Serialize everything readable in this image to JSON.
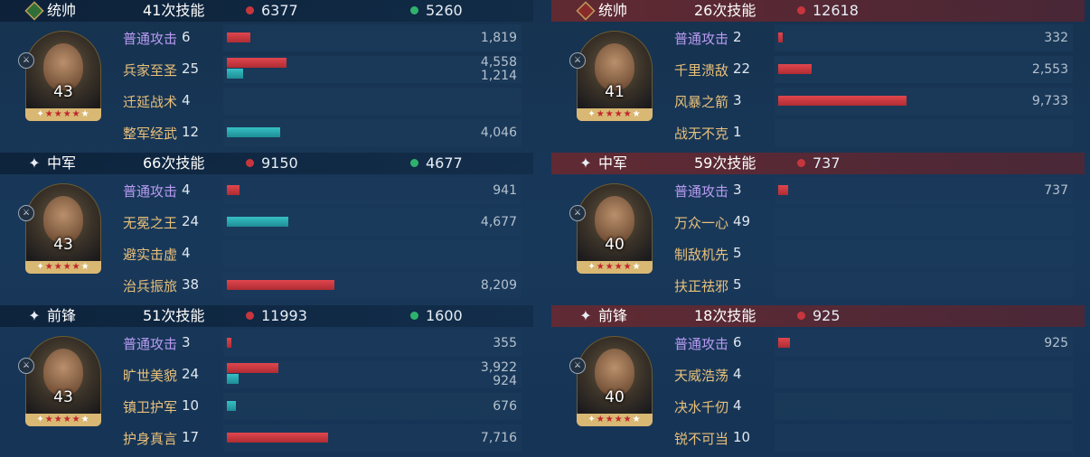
{
  "left": {
    "sections": [
      {
        "role": "统帅",
        "role_icon": "green-diamond-badge-icon",
        "skill_count": "41次技能",
        "damage": "6377",
        "heal": "5260",
        "level": "43",
        "skills": [
          {
            "name": "普通攻击",
            "count": "6",
            "normal": true,
            "red": 1819,
            "red_label": "1,819"
          },
          {
            "name": "兵家至圣",
            "count": "25",
            "red": 4558,
            "red_label": "4,558",
            "teal": 1214,
            "teal_label": "1,214"
          },
          {
            "name": "迁延战术",
            "count": "4"
          },
          {
            "name": "整军经武",
            "count": "12",
            "teal": 4046,
            "teal_label": "4,046"
          }
        ]
      },
      {
        "role": "中军",
        "role_icon": "sparkle-icon",
        "skill_count": "66次技能",
        "damage": "9150",
        "heal": "4677",
        "level": "43",
        "skills": [
          {
            "name": "普通攻击",
            "count": "4",
            "normal": true,
            "red": 941,
            "red_label": "941"
          },
          {
            "name": "无冕之王",
            "count": "24",
            "teal": 4677,
            "teal_label": "4,677"
          },
          {
            "name": "避实击虚",
            "count": "4"
          },
          {
            "name": "治兵振旅",
            "count": "38",
            "red": 8209,
            "red_label": "8,209"
          }
        ]
      },
      {
        "role": "前锋",
        "role_icon": "sparkle-icon",
        "skill_count": "51次技能",
        "damage": "11993",
        "heal": "1600",
        "level": "43",
        "skills": [
          {
            "name": "普通攻击",
            "count": "3",
            "normal": true,
            "red": 355,
            "red_label": "355"
          },
          {
            "name": "旷世美貌",
            "count": "24",
            "red": 3922,
            "red_label": "3,922",
            "teal": 924,
            "teal_label": "924"
          },
          {
            "name": "镇卫护军",
            "count": "10",
            "teal": 676,
            "teal_label": "676"
          },
          {
            "name": "护身真言",
            "count": "17",
            "red": 7716,
            "red_label": "7,716"
          }
        ]
      }
    ]
  },
  "right": {
    "sections": [
      {
        "role": "统帅",
        "role_icon": "red-diamond-badge-icon",
        "skill_count": "26次技能",
        "damage": "12618",
        "level": "41",
        "skills": [
          {
            "name": "普通攻击",
            "count": "2",
            "normal": true,
            "red": 332,
            "red_label": "332"
          },
          {
            "name": "千里溃敌",
            "count": "22",
            "red": 2553,
            "red_label": "2,553"
          },
          {
            "name": "风暴之箭",
            "count": "3",
            "red": 9733,
            "red_label": "9,733"
          },
          {
            "name": "战无不克",
            "count": "1"
          }
        ]
      },
      {
        "role": "中军",
        "role_icon": "sparkle-icon",
        "skill_count": "59次技能",
        "damage": "737",
        "level": "40",
        "skills": [
          {
            "name": "普通攻击",
            "count": "3",
            "normal": true,
            "red": 737,
            "red_label": "737"
          },
          {
            "name": "万众一心",
            "count": "49"
          },
          {
            "name": "制敌机先",
            "count": "5"
          },
          {
            "name": "扶正祛邪",
            "count": "5"
          }
        ]
      },
      {
        "role": "前锋",
        "role_icon": "sparkle-icon",
        "skill_count": "18次技能",
        "damage": "925",
        "level": "40",
        "skills": [
          {
            "name": "普通攻击",
            "count": "6",
            "normal": true,
            "red": 925,
            "red_label": "925"
          },
          {
            "name": "天威浩荡",
            "count": "4"
          },
          {
            "name": "决水千仞",
            "count": "4"
          },
          {
            "name": "锐不可当",
            "count": "10"
          }
        ]
      }
    ]
  },
  "colors": {
    "damage": "#c8363d",
    "heal": "#2fb36c",
    "skill_normal": "#b99bf2",
    "skill_tactic": "#e9c07a"
  }
}
